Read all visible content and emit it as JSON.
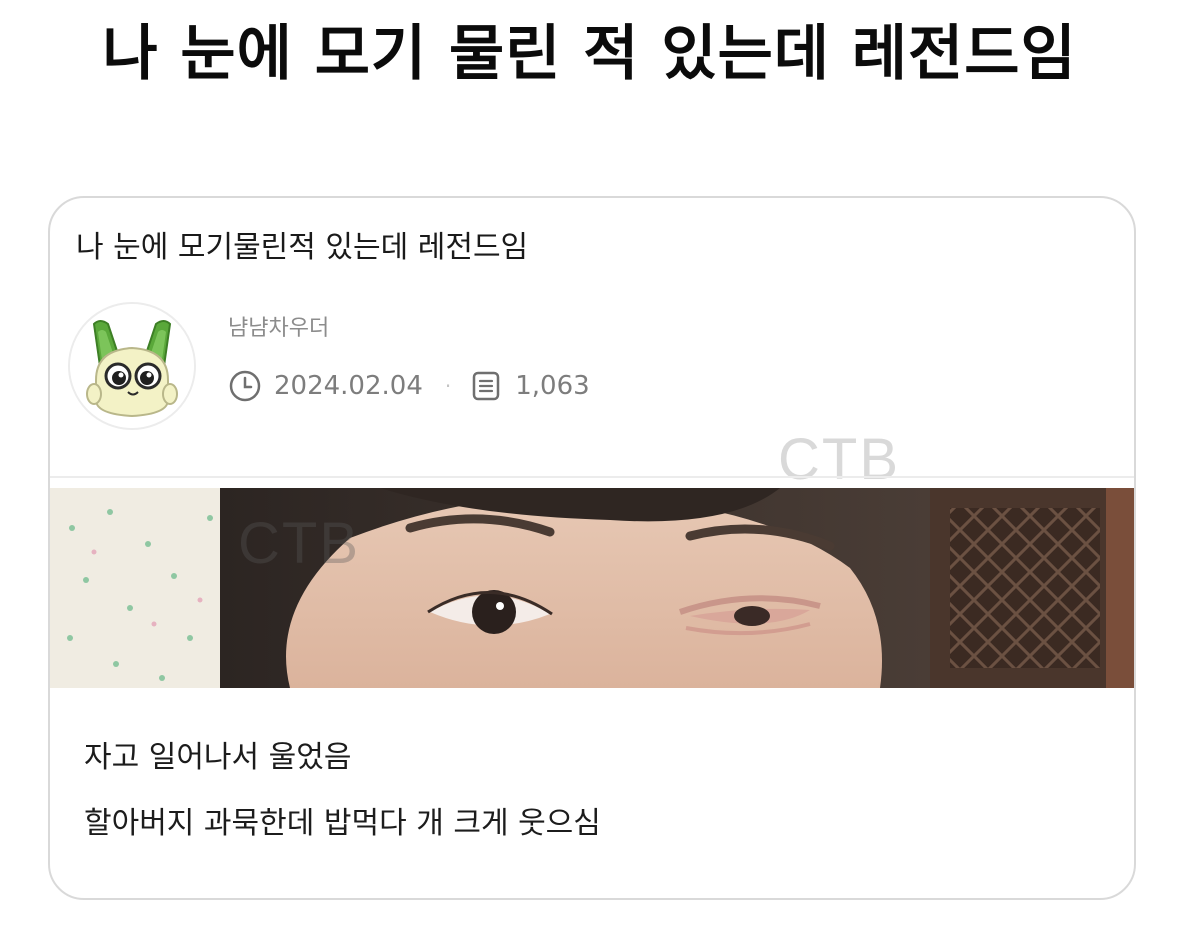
{
  "headline": "나 눈에 모기 물린 적 있는데 레전드임",
  "post": {
    "title": "나 눈에 모기물린적 있는데 레전드임",
    "author": "냠냠차우더",
    "date": "2024.02.04",
    "views": "1,063",
    "body_lines": [
      "자고 일어나서 울었음",
      "할아버지 과묵한데 밥먹다 개 크게 웃으심"
    ]
  },
  "watermarks": [
    "CTB",
    "CTB"
  ],
  "icons": {
    "date": "clock-icon",
    "views": "document-icon",
    "avatar": "green-cartoon-character-avatar"
  },
  "colors": {
    "meta_text": "#7d7d7d",
    "card_border": "#d9d9d9"
  }
}
